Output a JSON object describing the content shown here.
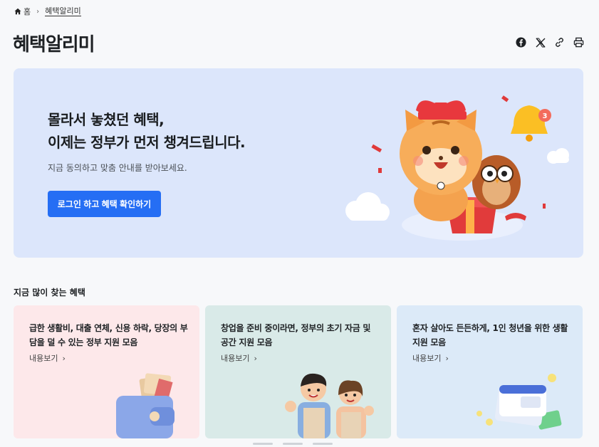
{
  "breadcrumb": {
    "home_label": "홈",
    "current": "혜택알리미"
  },
  "page": {
    "title": "혜택알리미"
  },
  "share": {
    "icons": [
      "facebook-icon",
      "x-icon",
      "link-icon",
      "print-icon"
    ]
  },
  "hero": {
    "title_line1": "몰라서 놓쳤던 혜택,",
    "title_line2": "이제는 정부가 먼저 챙겨드립니다.",
    "subtitle": "지금 동의하고 맞춤 안내를 받아보세요.",
    "button_label": "로그인 하고 혜택 확인하기",
    "badge_count": "3",
    "bg_color": "#dce6fb",
    "accent_color": "#256ef4"
  },
  "popular": {
    "title": "지금 많이 찾는 혜택",
    "cards": [
      {
        "text": "급한 생활비, 대출 연체, 신용 하락, 당장의 부담을 덜 수 있는 정부 지원 모음",
        "link": "내용보기",
        "bg": "#fde8ea"
      },
      {
        "text": "창업을 준비 중이라면, 정부의 초기 자금 및 공간 지원 모음",
        "link": "내용보기",
        "bg": "#d9eae8"
      },
      {
        "text": "혼자 살아도 든든하게, 1인 청년을 위한 생활지원 모음",
        "link": "내용보기",
        "bg": "#dceaf8"
      }
    ]
  }
}
